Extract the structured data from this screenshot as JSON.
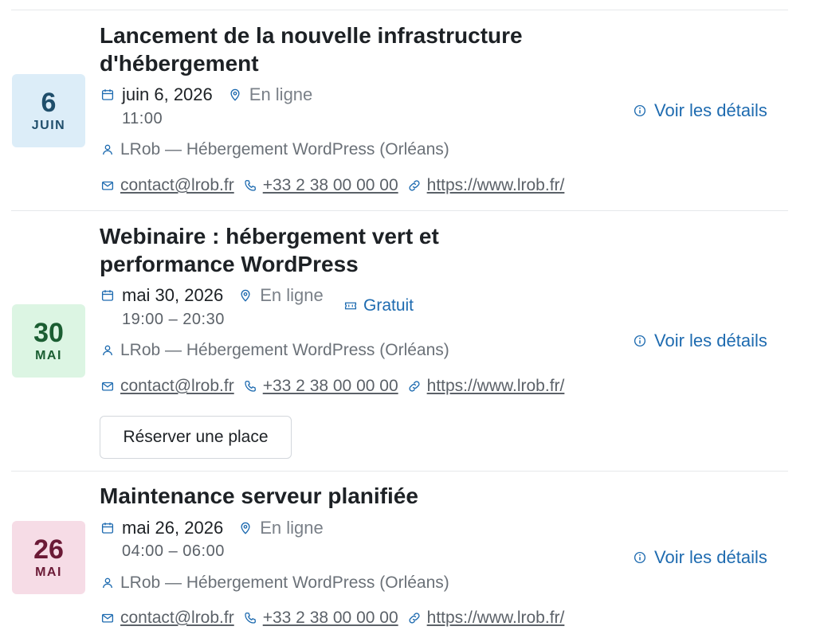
{
  "events": [
    {
      "day": "6",
      "month": "JUIN",
      "title": "Lancement de la nouvelle infrastructure d'hébergement",
      "date": "juin 6, 2026",
      "location": "En ligne",
      "time": "11:00",
      "organizer": "LRob — Hébergement WordPress (Orléans)",
      "email": "contact@lrob.fr",
      "phone": "+33 2 38 00 00 00",
      "website": "https://www.lrob.fr/",
      "details_label": "Voir les détails",
      "badge_bg": "#dcedf8",
      "badge_color": "#1f4e6b"
    },
    {
      "day": "30",
      "month": "MAI",
      "title": "Webinaire : hébergement vert et performance WordPress",
      "date": "mai 30, 2026",
      "location": "En ligne",
      "time": "19:00 – 20:30",
      "price": "Gratuit",
      "organizer": "LRob — Hébergement WordPress (Orléans)",
      "email": "contact@lrob.fr",
      "phone": "+33 2 38 00 00 00",
      "website": "https://www.lrob.fr/",
      "details_label": "Voir les détails",
      "reserve_label": "Réserver une place",
      "badge_bg": "#dcf5e3",
      "badge_color": "#1b5e32"
    },
    {
      "day": "26",
      "month": "MAI",
      "title": "Maintenance serveur planifiée",
      "date": "mai 26, 2026",
      "location": "En ligne",
      "time": "04:00 – 06:00",
      "organizer": "LRob — Hébergement WordPress (Orléans)",
      "email": "contact@lrob.fr",
      "phone": "+33 2 38 00 00 00",
      "website": "https://www.lrob.fr/",
      "details_label": "Voir les détails",
      "badge_bg": "#f6dce6",
      "badge_color": "#6b1a36"
    }
  ],
  "icons": {
    "calendar": "calendar-icon",
    "location": "map-pin-icon",
    "user": "user-icon",
    "email": "mail-icon",
    "phone": "phone-icon",
    "link": "link-icon",
    "info": "info-icon",
    "ticket": "ticket-icon"
  },
  "colors": {
    "accent": "#1e6bb0",
    "icon": "#1e6bb0"
  }
}
